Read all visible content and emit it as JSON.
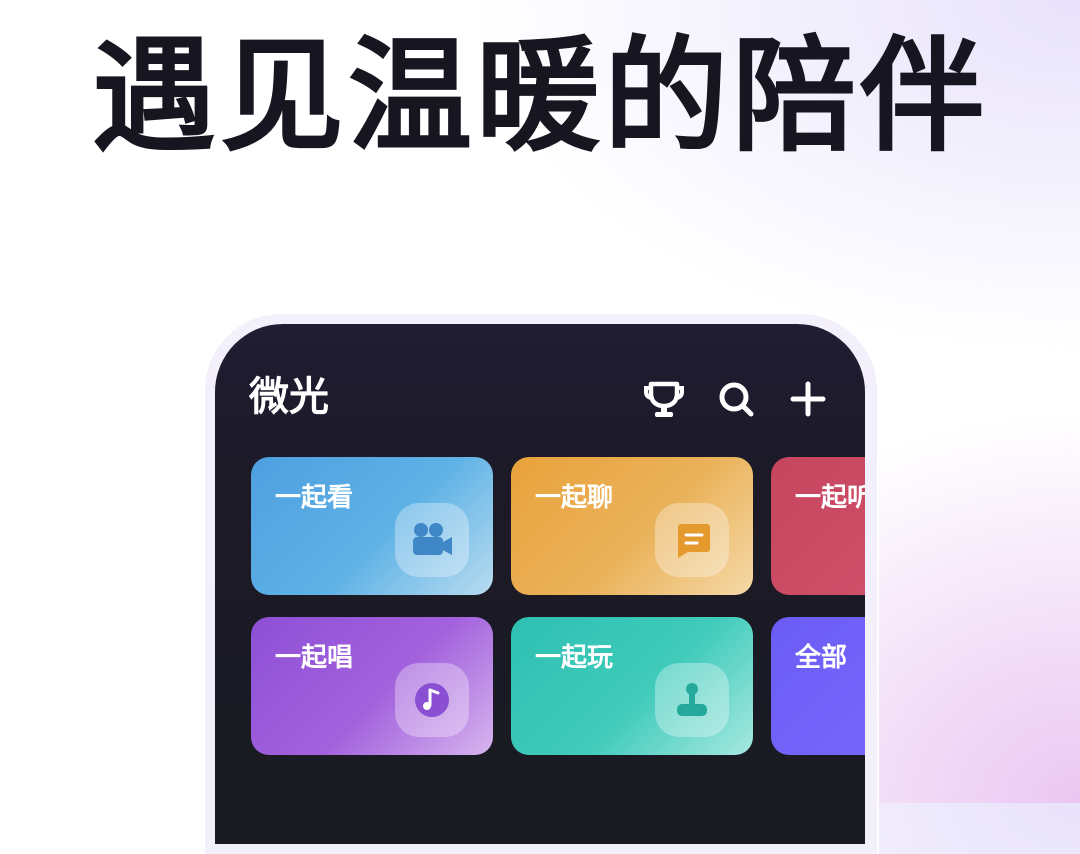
{
  "headline": "遇见温暖的陪伴",
  "app": {
    "title": "微光"
  },
  "toolbar": {
    "icons": [
      "trophy-icon",
      "search-icon",
      "plus-icon"
    ]
  },
  "categories": [
    {
      "label": "一起看",
      "icon": "video-camera-icon",
      "color": "#4e9fe0"
    },
    {
      "label": "一起聊",
      "icon": "chat-bubble-icon",
      "color": "#e9a23b"
    },
    {
      "label": "一起听",
      "icon": "",
      "color": "#c6455f"
    },
    {
      "label": "一起唱",
      "icon": "music-note-icon",
      "color": "#8d4fd6"
    },
    {
      "label": "一起玩",
      "icon": "joystick-icon",
      "color": "#2ec0b3"
    },
    {
      "label": "全部",
      "icon": "",
      "color": "#6b5cf5"
    }
  ]
}
